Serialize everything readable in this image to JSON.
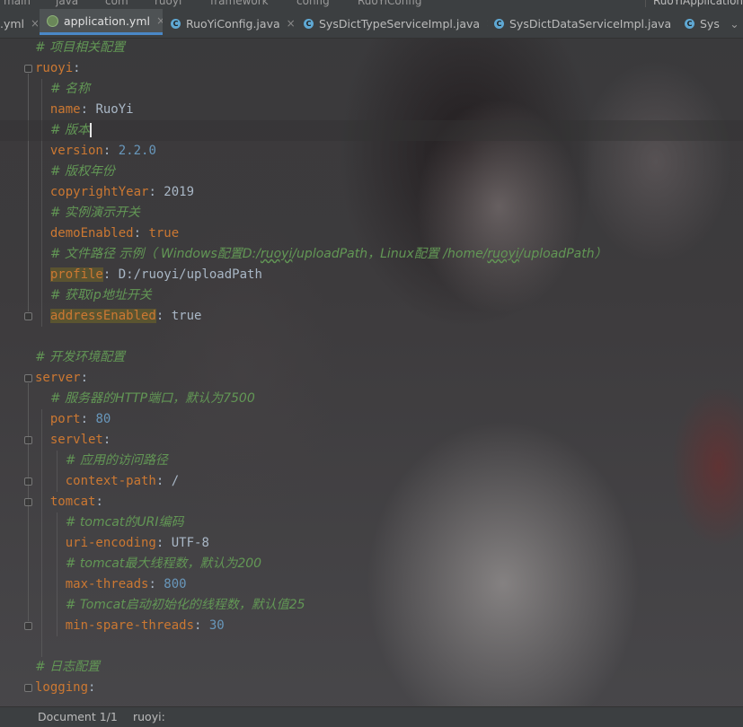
{
  "breadcrumb": [
    "main",
    "java",
    "com",
    "ruoyi",
    "framework",
    "config",
    "RuoYiConfig"
  ],
  "run_config": "RuoYiApplication",
  "tabs": [
    {
      "label": ".yml",
      "icon": "yaml-file-icon",
      "active": false,
      "closable": true
    },
    {
      "label": "application.yml",
      "icon": "yaml-file-icon",
      "active": true,
      "closable": true
    },
    {
      "label": "RuoYiConfig.java",
      "icon": "java-class-icon",
      "active": false,
      "closable": true
    },
    {
      "label": "SysDictTypeServiceImpl.java",
      "icon": "java-class-icon",
      "active": false,
      "closable": true
    },
    {
      "label": "SysDictDataServiceImpl.java",
      "icon": "java-class-icon",
      "active": false,
      "closable": true
    },
    {
      "label": "Sys",
      "icon": "java-class-icon",
      "active": false,
      "closable": false
    }
  ],
  "code_lines": [
    [
      {
        "t": "# 项目相关配置",
        "c": "cmt"
      }
    ],
    [
      {
        "t": "ruoyi",
        "c": "key"
      },
      {
        "t": ":",
        "c": "punct"
      }
    ],
    [
      {
        "t": "  "
      },
      {
        "t": "# 名称",
        "c": "cmt"
      }
    ],
    [
      {
        "t": "  "
      },
      {
        "t": "name",
        "c": "key"
      },
      {
        "t": ": ",
        "c": "punct"
      },
      {
        "t": "RuoYi",
        "c": "str"
      }
    ],
    [
      {
        "t": "  "
      },
      {
        "t": "# 版本",
        "c": "cmt"
      },
      {
        "caret": true
      }
    ],
    [
      {
        "t": "  "
      },
      {
        "t": "version",
        "c": "key"
      },
      {
        "t": ": ",
        "c": "punct"
      },
      {
        "t": "2.2.0",
        "c": "num"
      }
    ],
    [
      {
        "t": "  "
      },
      {
        "t": "# 版权年份",
        "c": "cmt"
      }
    ],
    [
      {
        "t": "  "
      },
      {
        "t": "copyrightYear",
        "c": "key"
      },
      {
        "t": ": ",
        "c": "punct"
      },
      {
        "t": "2019",
        "c": "str"
      }
    ],
    [
      {
        "t": "  "
      },
      {
        "t": "# 实例演示开关",
        "c": "cmt"
      }
    ],
    [
      {
        "t": "  "
      },
      {
        "t": "demoEnabled",
        "c": "key"
      },
      {
        "t": ": ",
        "c": "punct"
      },
      {
        "t": "true",
        "c": "bool"
      }
    ],
    [
      {
        "t": "  "
      },
      {
        "t": "# 文件路径 示例（ Windows配置D:/",
        "c": "cmt"
      },
      {
        "t": "ruoyi",
        "c": "cmt u"
      },
      {
        "t": "/uploadPath，Linux配置 /home/",
        "c": "cmt"
      },
      {
        "t": "ruoyi",
        "c": "cmt u"
      },
      {
        "t": "/uploadPath）",
        "c": "cmt"
      }
    ],
    [
      {
        "t": "  "
      },
      {
        "t": "profile",
        "c": "key-hl"
      },
      {
        "t": ": ",
        "c": "punct"
      },
      {
        "t": "D:/ruoyi/uploadPath",
        "c": "str"
      }
    ],
    [
      {
        "t": "  "
      },
      {
        "t": "# 获取ip地址开关",
        "c": "cmt"
      }
    ],
    [
      {
        "t": "  "
      },
      {
        "t": "addressEnabled",
        "c": "key-hl"
      },
      {
        "t": ": ",
        "c": "punct"
      },
      {
        "t": "true",
        "c": "str"
      }
    ],
    [],
    [
      {
        "t": "# 开发环境配置",
        "c": "cmt"
      }
    ],
    [
      {
        "t": "server",
        "c": "key"
      },
      {
        "t": ":",
        "c": "punct"
      }
    ],
    [
      {
        "t": "  "
      },
      {
        "t": "# 服务器的HTTP端口，默认为7500",
        "c": "cmt"
      }
    ],
    [
      {
        "t": "  "
      },
      {
        "t": "port",
        "c": "key"
      },
      {
        "t": ": ",
        "c": "punct"
      },
      {
        "t": "80",
        "c": "num"
      }
    ],
    [
      {
        "t": "  "
      },
      {
        "t": "servlet",
        "c": "key"
      },
      {
        "t": ":",
        "c": "punct"
      }
    ],
    [
      {
        "t": "    "
      },
      {
        "t": "# 应用的访问路径",
        "c": "cmt"
      }
    ],
    [
      {
        "t": "    "
      },
      {
        "t": "context-path",
        "c": "key"
      },
      {
        "t": ": ",
        "c": "punct"
      },
      {
        "t": "/",
        "c": "str"
      }
    ],
    [
      {
        "t": "  "
      },
      {
        "t": "tomcat",
        "c": "key"
      },
      {
        "t": ":",
        "c": "punct"
      }
    ],
    [
      {
        "t": "    "
      },
      {
        "t": "# tomcat的URI编码",
        "c": "cmt"
      }
    ],
    [
      {
        "t": "    "
      },
      {
        "t": "uri-encoding",
        "c": "key"
      },
      {
        "t": ": ",
        "c": "punct"
      },
      {
        "t": "UTF-8",
        "c": "str"
      }
    ],
    [
      {
        "t": "    "
      },
      {
        "t": "# tomcat最大线程数，默认为200",
        "c": "cmt"
      }
    ],
    [
      {
        "t": "    "
      },
      {
        "t": "max-threads",
        "c": "key"
      },
      {
        "t": ": ",
        "c": "punct"
      },
      {
        "t": "800",
        "c": "num"
      }
    ],
    [
      {
        "t": "    "
      },
      {
        "t": "# Tomcat启动初始化的线程数，默认值25",
        "c": "cmt"
      }
    ],
    [
      {
        "t": "    "
      },
      {
        "t": "min-spare-threads",
        "c": "key"
      },
      {
        "t": ": ",
        "c": "punct"
      },
      {
        "t": "30",
        "c": "num"
      }
    ],
    [],
    [
      {
        "t": "# 日志配置",
        "c": "cmt"
      }
    ],
    [
      {
        "t": "logging",
        "c": "key"
      },
      {
        "t": ":",
        "c": "punct"
      }
    ]
  ],
  "status": {
    "document": "Document 1/1",
    "path": "ruoyi:"
  }
}
